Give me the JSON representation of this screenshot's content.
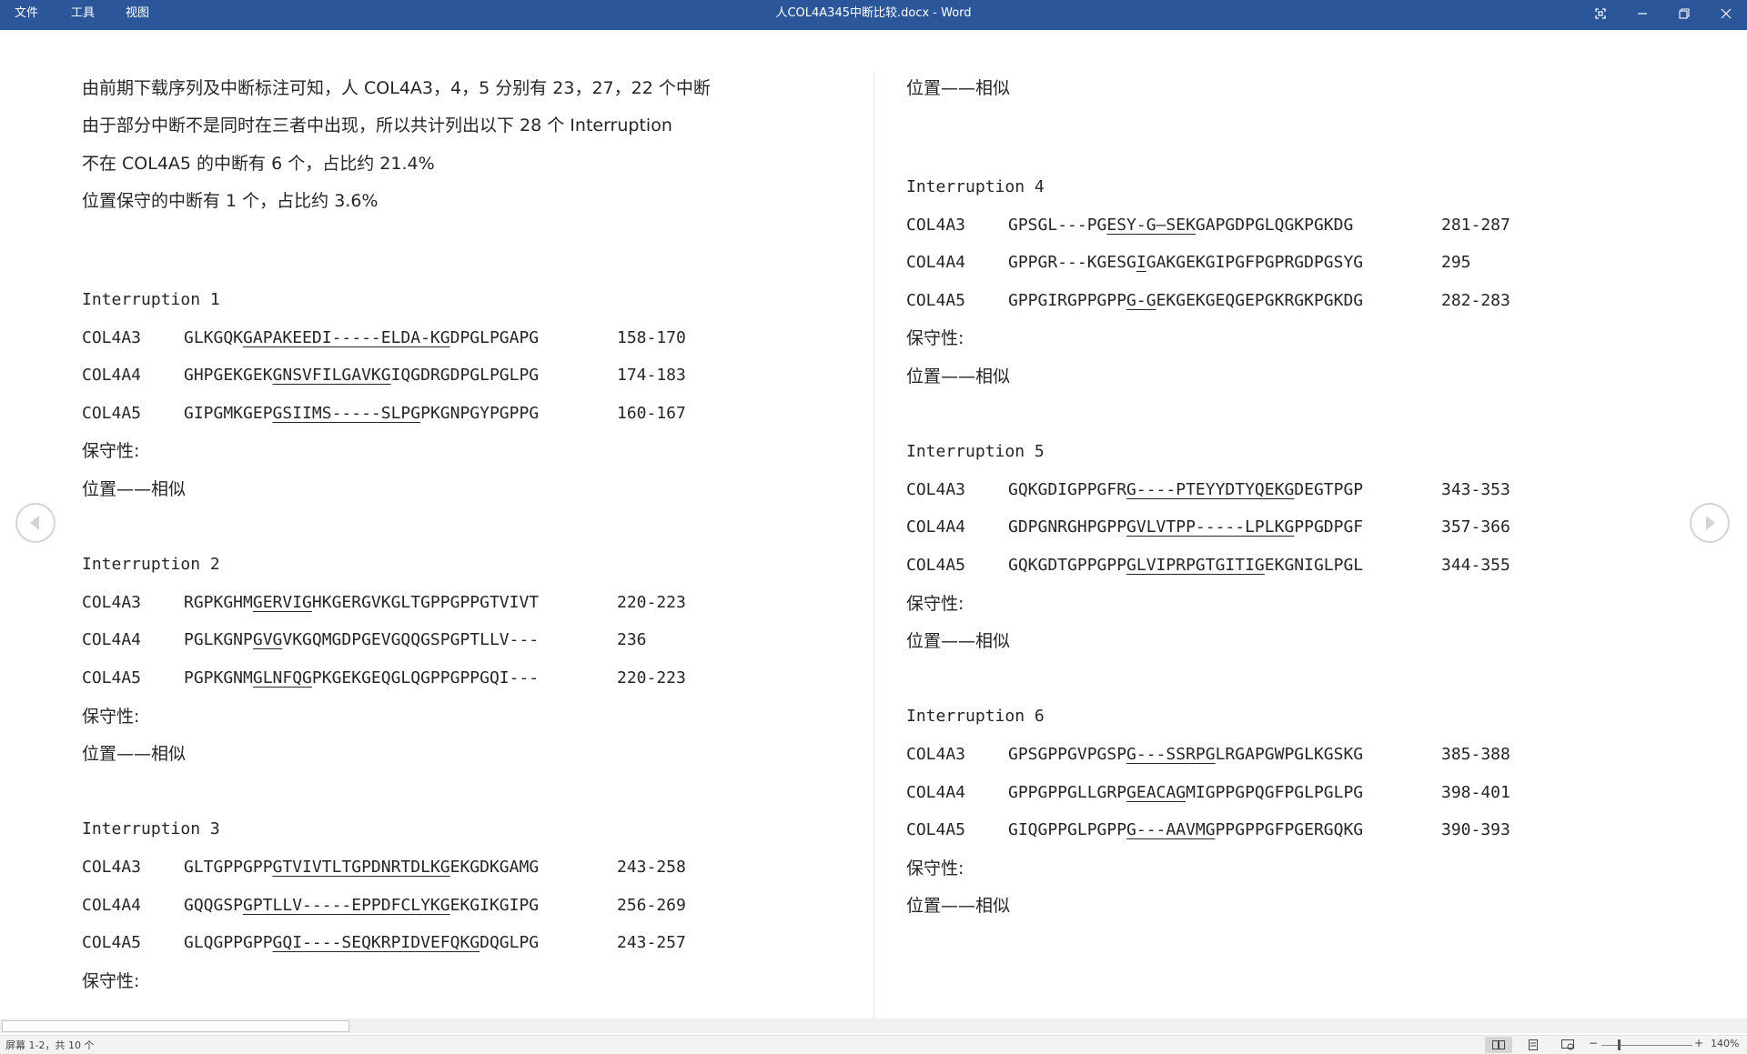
{
  "app": {
    "menu": [
      "文件",
      "工具",
      "视图"
    ],
    "window_title": "人COL4A345中断比较.docx  -  Word",
    "controls": [
      "fullscreen-icon",
      "minimize-icon",
      "restore-icon",
      "close-icon"
    ]
  },
  "intro": [
    "由前期下载序列及中断标注可知，人 COL4A3，4，5 分别有 23，27，22 个中断",
    "由于部分中断不是同时在三者中出现，所以共计列出以下 28 个 Interruption",
    "不在 COL4A5 的中断有 6 个，占比约 21.4%",
    "位置保守的中断有 1 个，占比约 3.6%"
  ],
  "left_interruptions": [
    {
      "title": "Interruption 1",
      "rows": [
        {
          "gene": "COL4A3",
          "pre": "GLKGQK",
          "u": "GAPAKEEDI-----ELDA-KG",
          "post": "DPGLPGAPG",
          "range": "158-170"
        },
        {
          "gene": "COL4A4",
          "pre": "GHPGEKGEK",
          "u": "GNSVFILGAVKG",
          "post": "IQGDRGDPGLPGLPG",
          "range": "174-183"
        },
        {
          "gene": "COL4A5",
          "pre": "GIPGMKGEP",
          "u": "GSIIMS-----SLPG",
          "post": "PKGNPGYPGPPG",
          "range": "160-167"
        }
      ],
      "conservation": "保守性:",
      "position": "位置——相似"
    },
    {
      "title": "Interruption 2",
      "rows": [
        {
          "gene": "COL4A3",
          "pre": "RGPKGHM",
          "u": "GERVIG",
          "post": "HKGERGVKGLTGPPGPPGTVIVT",
          "range": "220-223"
        },
        {
          "gene": "COL4A4",
          "pre": "PGLKGNP",
          "u": "GVG",
          "post": "VKGQMGDPGEVGQQGSPGPTLLV---",
          "range": "236"
        },
        {
          "gene": "COL4A5",
          "pre": "PGPKGNM",
          "u": "GLNFQG",
          "post": "PKGEKGEQGLQGPPGPPGQI---",
          "range": "220-223"
        }
      ],
      "conservation": "保守性:",
      "position": "位置——相似"
    },
    {
      "title": "Interruption 3",
      "rows": [
        {
          "gene": "COL4A3",
          "pre": "GLTGPPGPP",
          "u": "GTVIVTLTGPDNRTDLKG",
          "post": "EKGDKGAMG",
          "range": "243-258"
        },
        {
          "gene": "COL4A4",
          "pre": "GQQGSP",
          "u": "GPTLLV-----EPPDFCLYKG",
          "post": "EKGIKGIPG",
          "range": "256-269"
        },
        {
          "gene": "COL4A5",
          "pre": "GLQGPPGPP",
          "u": "GQI----SEQKRPIDVEFQKG",
          "post": "DQGLPG",
          "range": "243-257"
        }
      ],
      "conservation": "保守性:",
      "position": ""
    }
  ],
  "right_top_position": "位置——相似",
  "right_interruptions": [
    {
      "title": "Interruption 4",
      "rows": [
        {
          "gene": "COL4A3",
          "pre": "GPSGL---PG",
          "u": "ESY-G—SEK",
          "post": "GAPGDPGLQGKPGKDG",
          "range": "281-287"
        },
        {
          "gene": "COL4A4",
          "pre": "GPPGR---KGESG",
          "u": "I",
          "post": "GAKGEKGIPGFPGPRGDPGSYG",
          "range": "295"
        },
        {
          "gene": "COL4A5",
          "pre": "GPPGIRGPPGPP",
          "u": "G-G",
          "post": "EKGEKGEQGEPGKRGKPGKDG",
          "range": "282-283"
        }
      ],
      "conservation": "保守性:",
      "position": "位置——相似"
    },
    {
      "title": "Interruption 5",
      "rows": [
        {
          "gene": "COL4A3",
          "pre": "GQKGDIGPPGFR",
          "u": "G----PTEYYDTYQEKG",
          "post": "DEGTPGP",
          "range": "343-353"
        },
        {
          "gene": "COL4A4",
          "pre": "GDPGNRGHPGPP",
          "u": "GVLVTPP-----LPLKG",
          "post": "PPGDPGF",
          "range": "357-366"
        },
        {
          "gene": "COL4A5",
          "pre": "GQKGDTGPPGPP",
          "u": "GLVIPRPGTGITIG",
          "post": "EKGNIGLPGL",
          "range": "344-355"
        }
      ],
      "conservation": "保守性:",
      "position": "位置——相似"
    },
    {
      "title": "Interruption 6",
      "rows": [
        {
          "gene": "COL4A3",
          "pre": "GPSGPPGVPGSP",
          "u": "G---SSRPG",
          "post": "LRGAPGWPGLKGSKG",
          "range": "385-388"
        },
        {
          "gene": "COL4A4",
          "pre": "GPPGPPGLLGRP",
          "u": "GEACAG",
          "post": "MIGPPGPQGFPGLPGLPG",
          "range": "398-401"
        },
        {
          "gene": "COL4A5",
          "pre": "GIQGPPGLPGPP",
          "u": "G---AAVMG",
          "post": "PPGPPGFPGERGQKG",
          "range": "390-393"
        }
      ],
      "conservation": "保守性:",
      "position": "位置——相似"
    }
  ],
  "status": {
    "page_info": "屏幕 1-2，共 10 个",
    "zoom": "140%"
  }
}
